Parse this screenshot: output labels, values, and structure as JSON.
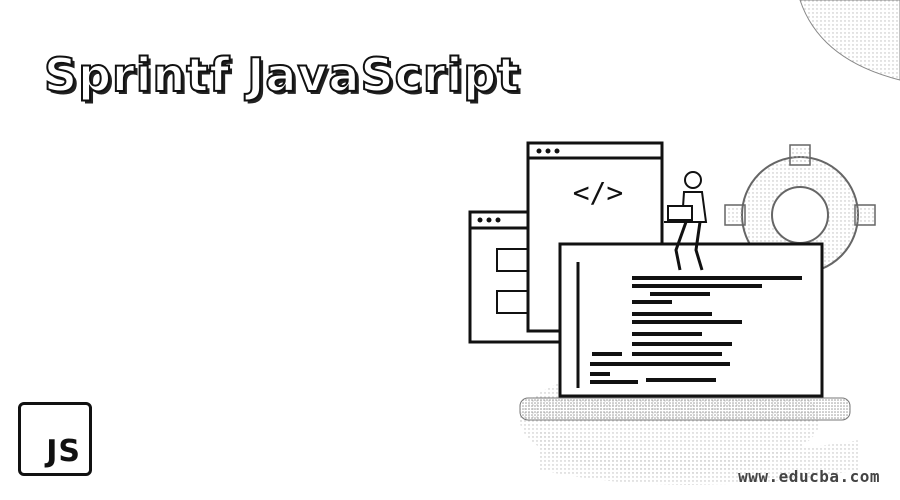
{
  "banner": {
    "title": "Sprintf JavaScript",
    "code_symbol": "</>",
    "badge_text": "JS",
    "watermark": "www.educba.com"
  },
  "icons": {
    "code_window": "code-window-icon",
    "gear": "gear-icon",
    "person": "person-with-laptop-icon",
    "badge": "js-badge-icon"
  }
}
